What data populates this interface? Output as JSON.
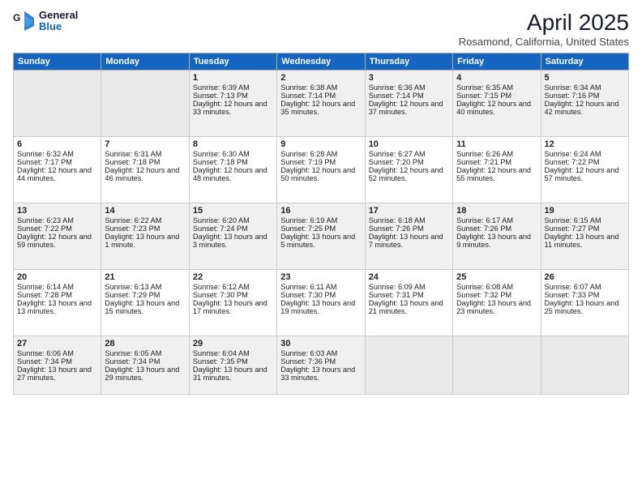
{
  "logo": {
    "general": "General",
    "blue": "Blue"
  },
  "title": "April 2025",
  "subtitle": "Rosamond, California, United States",
  "days": [
    "Sunday",
    "Monday",
    "Tuesday",
    "Wednesday",
    "Thursday",
    "Friday",
    "Saturday"
  ],
  "weeks": [
    [
      {
        "num": "",
        "empty": true
      },
      {
        "num": "",
        "empty": true
      },
      {
        "num": "1",
        "rise": "6:39 AM",
        "set": "7:13 PM",
        "daylight": "12 hours and 33 minutes."
      },
      {
        "num": "2",
        "rise": "6:38 AM",
        "set": "7:14 PM",
        "daylight": "12 hours and 35 minutes."
      },
      {
        "num": "3",
        "rise": "6:36 AM",
        "set": "7:14 PM",
        "daylight": "12 hours and 37 minutes."
      },
      {
        "num": "4",
        "rise": "6:35 AM",
        "set": "7:15 PM",
        "daylight": "12 hours and 40 minutes."
      },
      {
        "num": "5",
        "rise": "6:34 AM",
        "set": "7:16 PM",
        "daylight": "12 hours and 42 minutes."
      }
    ],
    [
      {
        "num": "6",
        "rise": "6:32 AM",
        "set": "7:17 PM",
        "daylight": "12 hours and 44 minutes."
      },
      {
        "num": "7",
        "rise": "6:31 AM",
        "set": "7:18 PM",
        "daylight": "12 hours and 46 minutes."
      },
      {
        "num": "8",
        "rise": "6:30 AM",
        "set": "7:18 PM",
        "daylight": "12 hours and 48 minutes."
      },
      {
        "num": "9",
        "rise": "6:28 AM",
        "set": "7:19 PM",
        "daylight": "12 hours and 50 minutes."
      },
      {
        "num": "10",
        "rise": "6:27 AM",
        "set": "7:20 PM",
        "daylight": "12 hours and 52 minutes."
      },
      {
        "num": "11",
        "rise": "6:26 AM",
        "set": "7:21 PM",
        "daylight": "12 hours and 55 minutes."
      },
      {
        "num": "12",
        "rise": "6:24 AM",
        "set": "7:22 PM",
        "daylight": "12 hours and 57 minutes."
      }
    ],
    [
      {
        "num": "13",
        "rise": "6:23 AM",
        "set": "7:22 PM",
        "daylight": "12 hours and 59 minutes."
      },
      {
        "num": "14",
        "rise": "6:22 AM",
        "set": "7:23 PM",
        "daylight": "13 hours and 1 minute."
      },
      {
        "num": "15",
        "rise": "6:20 AM",
        "set": "7:24 PM",
        "daylight": "13 hours and 3 minutes."
      },
      {
        "num": "16",
        "rise": "6:19 AM",
        "set": "7:25 PM",
        "daylight": "13 hours and 5 minutes."
      },
      {
        "num": "17",
        "rise": "6:18 AM",
        "set": "7:26 PM",
        "daylight": "13 hours and 7 minutes."
      },
      {
        "num": "18",
        "rise": "6:17 AM",
        "set": "7:26 PM",
        "daylight": "13 hours and 9 minutes."
      },
      {
        "num": "19",
        "rise": "6:15 AM",
        "set": "7:27 PM",
        "daylight": "13 hours and 11 minutes."
      }
    ],
    [
      {
        "num": "20",
        "rise": "6:14 AM",
        "set": "7:28 PM",
        "daylight": "13 hours and 13 minutes."
      },
      {
        "num": "21",
        "rise": "6:13 AM",
        "set": "7:29 PM",
        "daylight": "13 hours and 15 minutes."
      },
      {
        "num": "22",
        "rise": "6:12 AM",
        "set": "7:30 PM",
        "daylight": "13 hours and 17 minutes."
      },
      {
        "num": "23",
        "rise": "6:11 AM",
        "set": "7:30 PM",
        "daylight": "13 hours and 19 minutes."
      },
      {
        "num": "24",
        "rise": "6:09 AM",
        "set": "7:31 PM",
        "daylight": "13 hours and 21 minutes."
      },
      {
        "num": "25",
        "rise": "6:08 AM",
        "set": "7:32 PM",
        "daylight": "13 hours and 23 minutes."
      },
      {
        "num": "26",
        "rise": "6:07 AM",
        "set": "7:33 PM",
        "daylight": "13 hours and 25 minutes."
      }
    ],
    [
      {
        "num": "27",
        "rise": "6:06 AM",
        "set": "7:34 PM",
        "daylight": "13 hours and 27 minutes."
      },
      {
        "num": "28",
        "rise": "6:05 AM",
        "set": "7:34 PM",
        "daylight": "13 hours and 29 minutes."
      },
      {
        "num": "29",
        "rise": "6:04 AM",
        "set": "7:35 PM",
        "daylight": "13 hours and 31 minutes."
      },
      {
        "num": "30",
        "rise": "6:03 AM",
        "set": "7:36 PM",
        "daylight": "13 hours and 33 minutes."
      },
      {
        "num": "",
        "empty": true
      },
      {
        "num": "",
        "empty": true
      },
      {
        "num": "",
        "empty": true
      }
    ]
  ]
}
